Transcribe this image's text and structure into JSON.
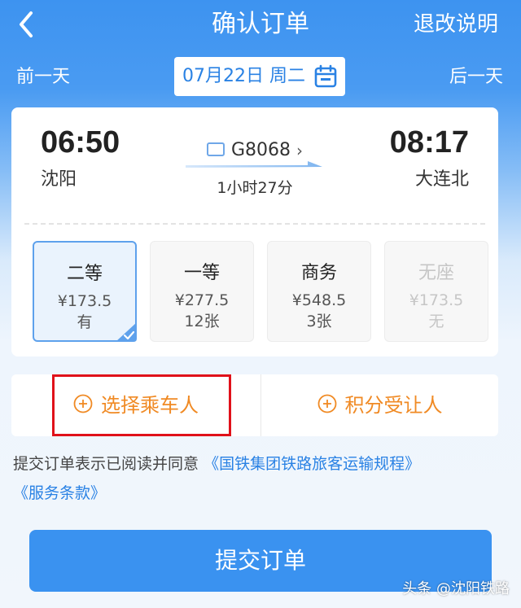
{
  "header": {
    "title": "确认订单",
    "right_link": "退改说明"
  },
  "date_bar": {
    "prev_label": "前一天",
    "date": "07月22日 周二",
    "next_label": "后一天"
  },
  "trip": {
    "depart_time": "06:50",
    "depart_station": "沈阳",
    "train_no": "G8068",
    "chevron": "›",
    "duration": "1小时27分",
    "arrive_time": "08:17",
    "arrive_station": "大连北"
  },
  "seats": [
    {
      "name": "二等",
      "price": "¥173.5",
      "availability": "有",
      "selected": true,
      "disabled": false
    },
    {
      "name": "一等",
      "price": "¥277.5",
      "availability": "12张",
      "selected": false,
      "disabled": false
    },
    {
      "name": "商务",
      "price": "¥548.5",
      "availability": "3张",
      "selected": false,
      "disabled": false
    },
    {
      "name": "无座",
      "price": "¥173.5",
      "availability": "无",
      "selected": false,
      "disabled": true
    }
  ],
  "actions": {
    "select_passenger": "选择乘车人",
    "points_transferee": "积分受让人"
  },
  "agreement": {
    "text": "提交订单表示已阅读并同意",
    "link1": "《国铁集团铁路旅客运输规程》",
    "link2": "《服务条款》"
  },
  "submit_label": "提交订单",
  "watermark": "头条 @沈阳铁路",
  "colors": {
    "header_blue": "#3d93f0",
    "link_blue": "#2a82e4",
    "action_orange": "#f08a24",
    "highlight_red": "#e0111a",
    "submit_blue": "#3a92f0"
  },
  "icons": [
    "back-arrow",
    "calendar",
    "id-card",
    "check",
    "plus-circle"
  ]
}
